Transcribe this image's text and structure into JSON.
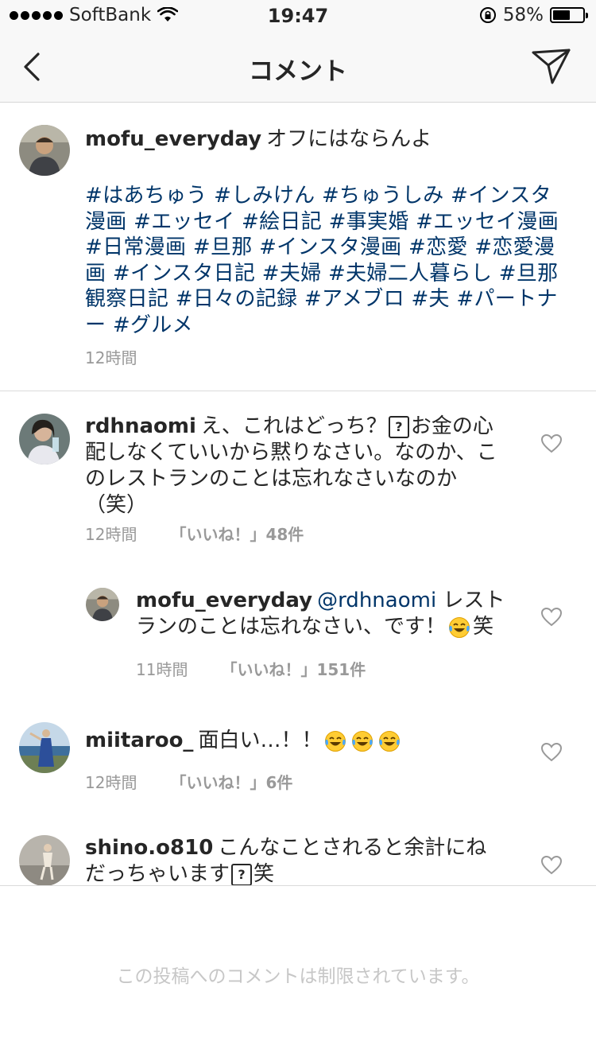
{
  "status": {
    "carrier": "SoftBank",
    "time": "19:47",
    "battery": "58%",
    "battery_level": 0.58
  },
  "nav": {
    "title": "コメント"
  },
  "caption": {
    "username": "mofu_everyday",
    "text": "オフにはならんよ",
    "hashtags": "#はあちゅう #しみけん #ちゅうしみ #インスタ漫画 #エッセイ #絵日記 #事実婚 #エッセイ漫画 #日常漫画 #旦那 #インスタ漫画 #恋愛 #恋愛漫画 #インスタ日記 #夫婦 #夫婦二人暮らし #旦那観察日記 #日々の記録 #アメブロ #夫 #パートナー #グルメ",
    "time": "12時間"
  },
  "comments": [
    {
      "username": "rdhnaomi",
      "text_part1": "え、これはどっち？",
      "text_part2": "お金の心配しなくていいから黙りなさい。なのか、このレストランのことは忘れなさいなのか（笑）",
      "time": "12時間",
      "likes": "「いいね！」48件"
    },
    {
      "username": "mofu_everyday",
      "mention": "@rdhnaomi",
      "text_part1": "レストランのことは忘れなさい、です！",
      "text_part2": "笑",
      "time": "11時間",
      "likes": "「いいね！」151件"
    },
    {
      "username": "miitaroo_",
      "text_part1": "面白い…！！",
      "time": "12時間",
      "likes": "「いいね！」6件"
    },
    {
      "username": "shino.o810",
      "text_part1": "こんなことされると余計にねだっちゃいます",
      "text_part2": "笑"
    }
  ],
  "icons": {
    "placeholder_glyph": "?"
  },
  "footer": {
    "restricted_text": "この投稿へのコメントは制限されています。"
  }
}
